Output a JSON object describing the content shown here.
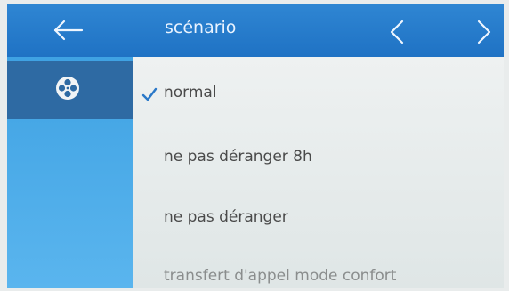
{
  "header": {
    "title": "scénario"
  },
  "icons": {
    "back": "arrow-left-icon",
    "prev": "chevron-left-icon",
    "next": "chevron-right-icon",
    "scenario": "film-reel-icon",
    "check": "checkmark-icon"
  },
  "scenarios": {
    "selected": "normal",
    "items": [
      {
        "label": "normal"
      },
      {
        "label": "ne pas déranger 8h"
      },
      {
        "label": "ne pas déranger"
      },
      {
        "label": "transfert d'appel mode confort"
      }
    ]
  },
  "colors": {
    "header": "#1f72c4",
    "sidebar": "#4aa9e8",
    "sidebar_active": "#2e6aa3",
    "check": "#2a78c8"
  }
}
